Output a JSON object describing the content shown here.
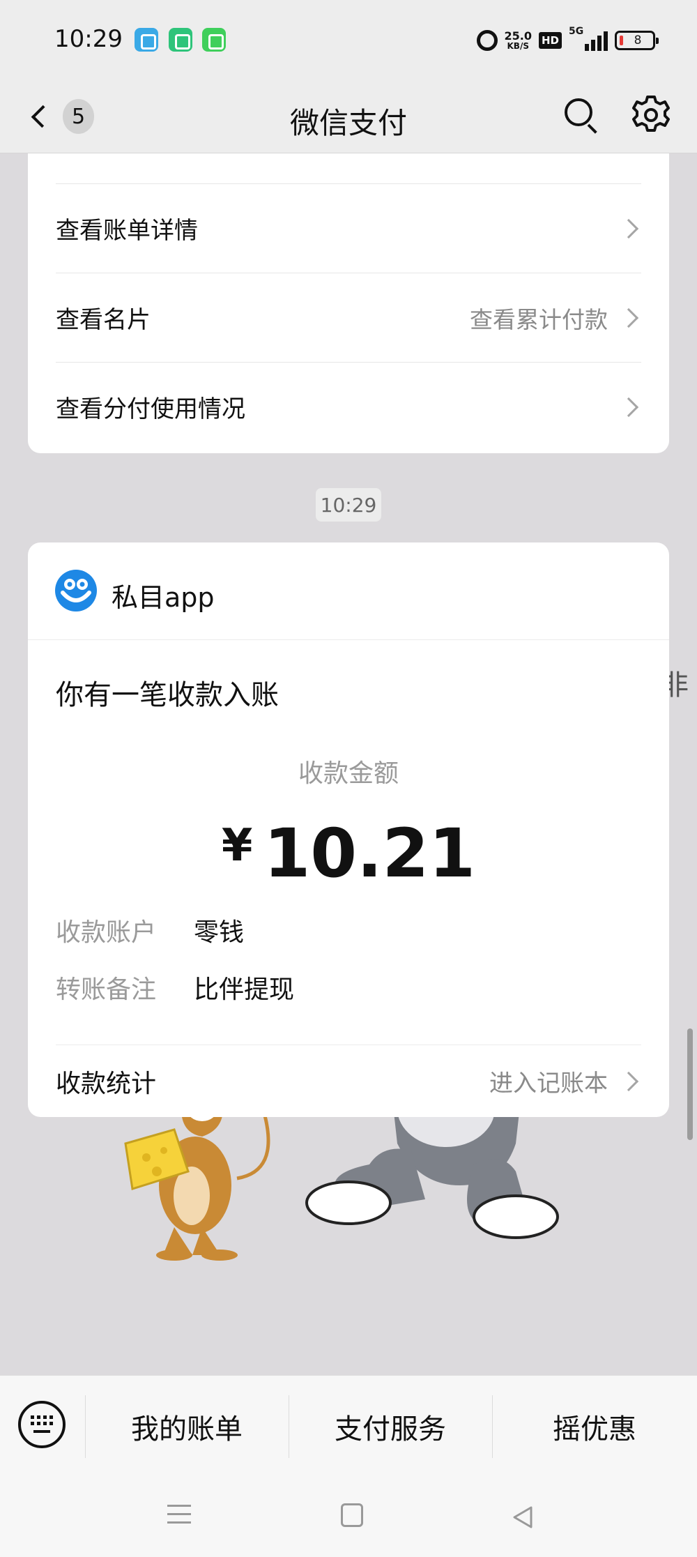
{
  "status_bar": {
    "time": "10:29",
    "network_speed_value": "25.0",
    "network_speed_unit": "KB/S",
    "hd_label": "HD",
    "signal_label": "5G",
    "battery_level": "8",
    "notification_icons": [
      "bird-app-icon",
      "battery-saver-icon",
      "messages-icon"
    ]
  },
  "nav": {
    "unread_count": "5",
    "title": "微信支付"
  },
  "top_card": {
    "rows": [
      {
        "label": "查看账单详情",
        "hint": ""
      },
      {
        "label": "查看名片",
        "hint": "查看累计付款"
      },
      {
        "label": "查看分付使用情况",
        "hint": ""
      }
    ]
  },
  "timestamp": "10:29",
  "payment_card": {
    "app_name": "私目app",
    "title": "你有一笔收款入账",
    "amount_label": "收款金额",
    "currency_symbol": "¥",
    "amount": "10.21",
    "details": [
      {
        "key": "收款账户",
        "value": "零钱"
      },
      {
        "key": "转账备注",
        "value": "比伴提现"
      }
    ],
    "footer_label": "收款统计",
    "footer_hint": "进入记账本"
  },
  "right_edge_glyph": "非",
  "bottom_menu": {
    "items": [
      "我的账单",
      "支付服务",
      "摇优惠"
    ]
  },
  "colors": {
    "background": "#dcdadd",
    "bar_background": "#ededed",
    "card": "#ffffff",
    "secondary_text": "#8a8a8a",
    "app_logo_blue": "#1e88e5"
  }
}
